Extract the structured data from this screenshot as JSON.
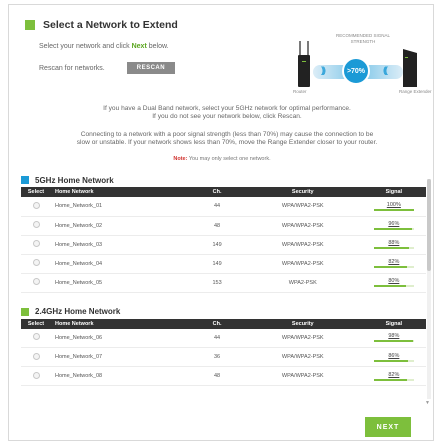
{
  "page": {
    "title": "Select a Network to Extend",
    "intro_before": "Select your network and click ",
    "intro_next": "Next",
    "intro_after": " below.",
    "rescan_label": "Rescan for networks.",
    "rescan_button": "RESCAN"
  },
  "diagram": {
    "recommended_label": "RECOMMENDED SIGNAL STRENGTH",
    "percent": ">70%",
    "router_label": "Router",
    "extender_label": "Range Extender"
  },
  "info": {
    "line1": "If you have a Dual Band network, select your 5GHz network for optimal performance.",
    "line1b": "If you do not see your network below, click Rescan.",
    "line2": "Connecting to a network with a poor signal strength (less than 70%) may cause the connection to be",
    "line2b": "slow or unstable. If your network shows less than 70%, move the Range Extender closer to your router.",
    "note_label": "Note:",
    "note_text": " You may only select one network."
  },
  "table_headers": {
    "select": "Select",
    "name": "Home Network",
    "ch": "Ch.",
    "security": "Security",
    "signal": "Signal"
  },
  "sections": [
    {
      "title": "5GHz Home Network",
      "rows": [
        {
          "name": "Home_Network_01",
          "ch": "44",
          "security": "WPA/WPA2-PSK",
          "signal": "100%",
          "level": 1.0
        },
        {
          "name": "Home_Network_02",
          "ch": "48",
          "security": "WPA/WPA2-PSK",
          "signal": "96%",
          "level": 0.96
        },
        {
          "name": "Home_Network_03",
          "ch": "149",
          "security": "WPA/WPA2-PSK",
          "signal": "88%",
          "level": 0.88
        },
        {
          "name": "Home_Network_04",
          "ch": "149",
          "security": "WPA/WPA2-PSK",
          "signal": "82%",
          "level": 0.82
        },
        {
          "name": "Home_Network_05",
          "ch": "153",
          "security": "WPA2-PSK",
          "signal": "80%",
          "level": 0.8
        }
      ]
    },
    {
      "title": "2.4GHz Home Network",
      "rows": [
        {
          "name": "Home_Network_06",
          "ch": "44",
          "security": "WPA/WPA2-PSK",
          "signal": "98%",
          "level": 0.98
        },
        {
          "name": "Home_Network_07",
          "ch": "36",
          "security": "WPA/WPA2-PSK",
          "signal": "86%",
          "level": 0.86
        },
        {
          "name": "Home_Network_08",
          "ch": "48",
          "security": "WPA/WPA2-PSK",
          "signal": "82%",
          "level": 0.82
        }
      ]
    }
  ],
  "footer": {
    "next_button": "NEXT"
  },
  "colors": {
    "accent_green": "#7dbf3c",
    "accent_blue": "#1b9ad6",
    "header_dark": "#333333",
    "note_red": "#d0312d"
  }
}
